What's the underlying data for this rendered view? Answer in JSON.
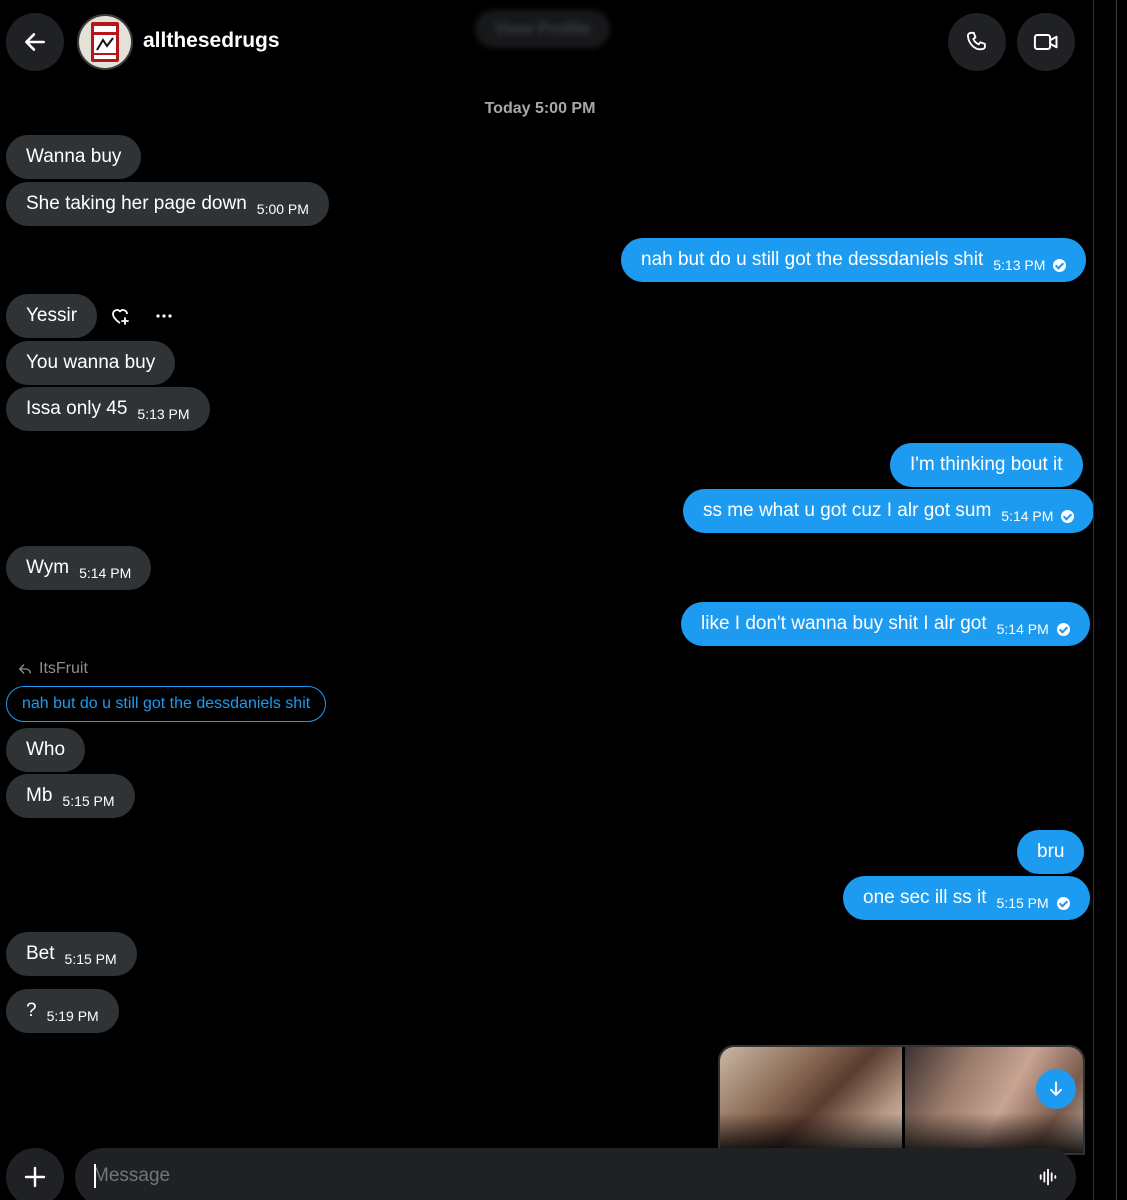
{
  "header": {
    "username": "allthesedrugs",
    "view_profile": "View Profile",
    "icons": [
      "back-arrow-icon",
      "phone-icon",
      "video-camera-icon"
    ]
  },
  "date_separator": "Today 5:00 PM",
  "messages": {
    "m1": {
      "text": "Wanna buy",
      "time": ""
    },
    "m2": {
      "text": "She taking her page down",
      "time": "5:00 PM"
    },
    "m3": {
      "text": "nah but do u still got the dessdaniels shit",
      "time": "5:13 PM"
    },
    "m4": {
      "text": "Yessir",
      "time": ""
    },
    "m5": {
      "text": "You wanna buy",
      "time": ""
    },
    "m6": {
      "text": "Issa only 45",
      "time": "5:13 PM"
    },
    "m7": {
      "text": "I'm thinking bout it",
      "time": ""
    },
    "m8": {
      "text": "ss me what u got cuz I alr got sum",
      "time": "5:14 PM"
    },
    "m9": {
      "text": "Wym",
      "time": "5:14 PM"
    },
    "m10": {
      "text": "like I don't wanna buy shit I alr got",
      "time": "5:14 PM"
    },
    "m11": {
      "text": "Who",
      "time": ""
    },
    "m12": {
      "text": "Mb",
      "time": "5:15 PM"
    },
    "m13": {
      "text": "bru",
      "time": ""
    },
    "m14": {
      "text": "one sec ill ss it",
      "time": "5:15 PM"
    },
    "m15": {
      "text": "Bet",
      "time": "5:15 PM"
    },
    "m16": {
      "text": "?",
      "time": "5:19 PM"
    }
  },
  "reply": {
    "label": "ItsFruit",
    "quoted_text": "nah but do u still got the dessdaniels shit"
  },
  "composer": {
    "placeholder": "Message"
  },
  "colors": {
    "background": "#000000",
    "incoming_bubble": "#2f3336",
    "outgoing_bubble": "#1d9bf0",
    "accent": "#1d9bf0"
  }
}
